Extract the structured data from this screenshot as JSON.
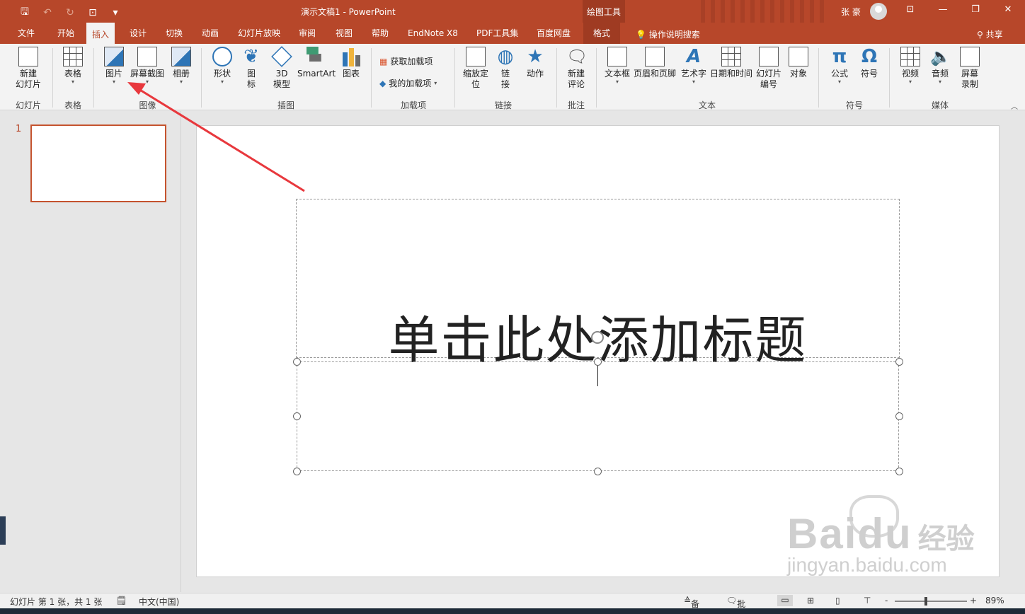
{
  "titlebar": {
    "doc_title": "演示文稿1  -  PowerPoint",
    "context_tool": "绘图工具",
    "user": "张 豪",
    "qat": {
      "save": "🖫",
      "undo": "↶",
      "redo": "↻",
      "present": "⊡",
      "more": "▾"
    },
    "win": {
      "ribbon_opts": "⊡",
      "minimize": "—",
      "restore": "❐",
      "close": "✕"
    }
  },
  "tabs": {
    "file": "文件",
    "home": "开始",
    "insert": "插入",
    "design": "设计",
    "transitions": "切换",
    "animations": "动画",
    "slideshow": "幻灯片放映",
    "review": "审阅",
    "view": "视图",
    "help": "帮助",
    "endnote": "EndNote X8",
    "pdf": "PDF工具集",
    "baidu": "百度网盘",
    "format": "格式",
    "tellme": "操作说明搜索",
    "share": "共享"
  },
  "ribbon": {
    "new_slide": "新建\n幻灯片",
    "table": "表格",
    "picture": "图片",
    "screenshot": "屏幕截图",
    "album": "相册",
    "shapes": "形状",
    "icons": "图\n标",
    "model3d": "3D\n模型",
    "smartart": "SmartArt",
    "chart": "图表",
    "get_addins": "获取加载项",
    "my_addins": "我的加载项",
    "zoom": "缩放定\n位",
    "link": "链\n接",
    "action": "动作",
    "new_comment": "新建\n评论",
    "textbox": "文本框",
    "header_footer": "页眉和页脚",
    "wordart": "艺术字",
    "datetime": "日期和时间",
    "slide_number": "幻灯片\n编号",
    "object": "对象",
    "equation": "公式",
    "symbol": "符号",
    "video": "视频",
    "audio": "音频",
    "screen_record": "屏幕\n录制"
  },
  "groups": {
    "slides": "幻灯片",
    "tables": "表格",
    "images": "图像",
    "illustrations": "插图",
    "addins": "加载项",
    "links": "链接",
    "comments": "批注",
    "text": "文本",
    "symbols": "符号",
    "media": "媒体"
  },
  "thumbnails": {
    "slide_number": "1"
  },
  "slide": {
    "title_placeholder": "单击此处添加标题"
  },
  "statusbar": {
    "slide_info": "幻灯片 第 1 张，共 1 张",
    "language": "中文(中国)",
    "notes": "备注",
    "comments": "批注",
    "zoom": "89%",
    "zoom_minus": "-",
    "zoom_plus": "+"
  },
  "watermark": {
    "brand": "Bai",
    "brand2": "du",
    "zh": "经验",
    "url": "jingyan.baidu.com"
  },
  "colors": {
    "accent": "#b7472a",
    "annotation_arrow": "#e8383d"
  }
}
